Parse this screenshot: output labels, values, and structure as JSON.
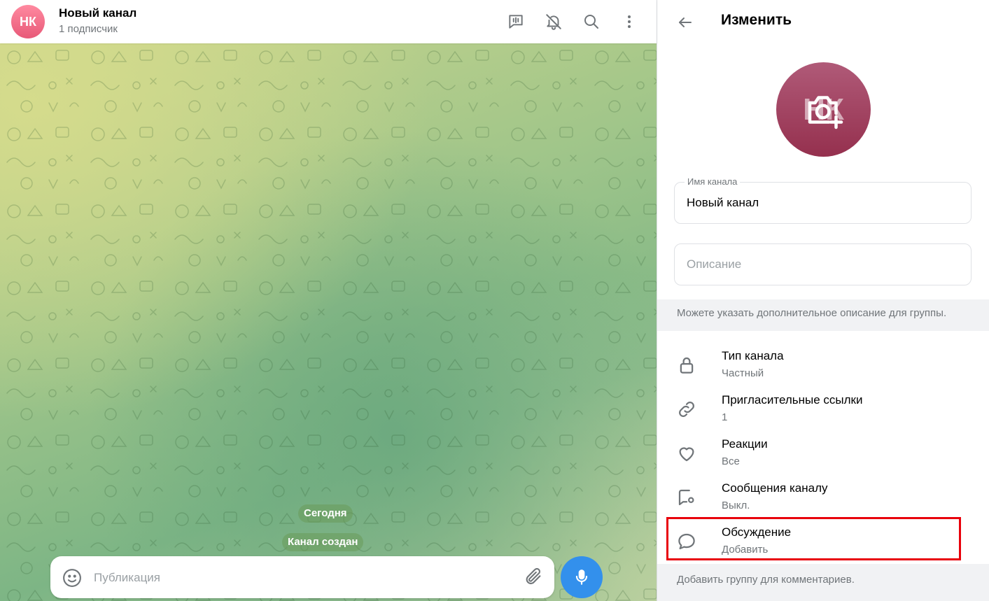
{
  "chat": {
    "avatar_initials": "НК",
    "title": "Новый канал",
    "subtitle": "1 подписчик",
    "header_icons": [
      "live-stream-icon",
      "bell-off-icon",
      "search-icon",
      "more-vertical-icon"
    ],
    "service_today": "Сегодня",
    "service_created": "Канал создан",
    "composer_placeholder": "Публикация"
  },
  "panel": {
    "title": "Изменить",
    "photo_initials": "НК",
    "name_label": "Имя канала",
    "name_value": "Новый канал",
    "description_placeholder": "Описание",
    "description_hint": "Можете указать дополнительное описание для группы.",
    "rows": [
      {
        "title": "Тип канала",
        "subtitle": "Частный",
        "icon": "lock-icon"
      },
      {
        "title": "Пригласительные ссылки",
        "subtitle": "1",
        "icon": "link-icon"
      },
      {
        "title": "Реакции",
        "subtitle": "Все",
        "icon": "heart-icon"
      },
      {
        "title": "Сообщения каналу",
        "subtitle": "Выкл.",
        "icon": "chat-settings-icon"
      },
      {
        "title": "Обсуждение",
        "subtitle": "Добавить",
        "icon": "comment-icon"
      }
    ],
    "discussion_hint": "Добавить группу для комментариев."
  },
  "colors": {
    "accent": "#3390ec",
    "highlight": "#e8000b",
    "avatar": "#e85a78",
    "photo": "#95304e"
  }
}
